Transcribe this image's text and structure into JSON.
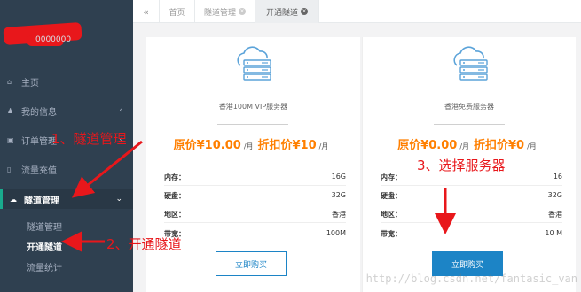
{
  "sidebar": {
    "profile_line": "0000000",
    "items": [
      {
        "label": "主页",
        "icon": "home-icon",
        "glyph": "⌂"
      },
      {
        "label": "我的信息",
        "icon": "user-icon",
        "glyph": "♟",
        "chevron": "‹"
      },
      {
        "label": "订单管理",
        "icon": "cart-icon",
        "glyph": "▣",
        "chevron": "‹"
      },
      {
        "label": "流量充值",
        "icon": "flow-icon",
        "glyph": "▯"
      },
      {
        "label": "隧道管理",
        "icon": "cloud-icon",
        "glyph": "☁",
        "chevron": "⌄"
      }
    ],
    "subitems": [
      {
        "label": "隧道管理"
      },
      {
        "label": "开通隧道"
      },
      {
        "label": "流量统计"
      }
    ]
  },
  "tabs": {
    "back_glyph": "«",
    "home": "首页",
    "tunnel_manage": "隧道管理",
    "open_tunnel": "开通隧道",
    "close_glyph": "×"
  },
  "plans": [
    {
      "name": "香港100M VIP服务器",
      "original_label": "原价¥10.00",
      "per_month": "/月",
      "discount_label": "折扣价¥10",
      "specs": [
        {
          "key": "内存：",
          "value": "16G"
        },
        {
          "key": "硬盘：",
          "value": "32G"
        },
        {
          "key": "地区：",
          "value": "香港"
        },
        {
          "key": "带宽：",
          "value": "100M"
        }
      ],
      "buy_label": "立即购买"
    },
    {
      "name": "香港免费服务器",
      "original_label": "原价¥0.00",
      "per_month": "/月",
      "discount_label": "折扣价¥0",
      "specs": [
        {
          "key": "内存：",
          "value": "16"
        },
        {
          "key": "硬盘：",
          "value": "32G"
        },
        {
          "key": "地区：",
          "value": "香港"
        },
        {
          "key": "带宽：",
          "value": "10 M"
        }
      ],
      "buy_label": "立即购买"
    }
  ],
  "annotations": {
    "step1": "1、隧道管理",
    "step2": "2、开通隧道",
    "step3": "3、选择服务器"
  },
  "watermark": "http://blog.csdn.net/fantasic_van",
  "colors": {
    "sidebar_bg": "#2f4050",
    "accent_orange": "#ff7f00",
    "button_blue": "#1c84c6",
    "annotation_red": "#e8171b"
  }
}
